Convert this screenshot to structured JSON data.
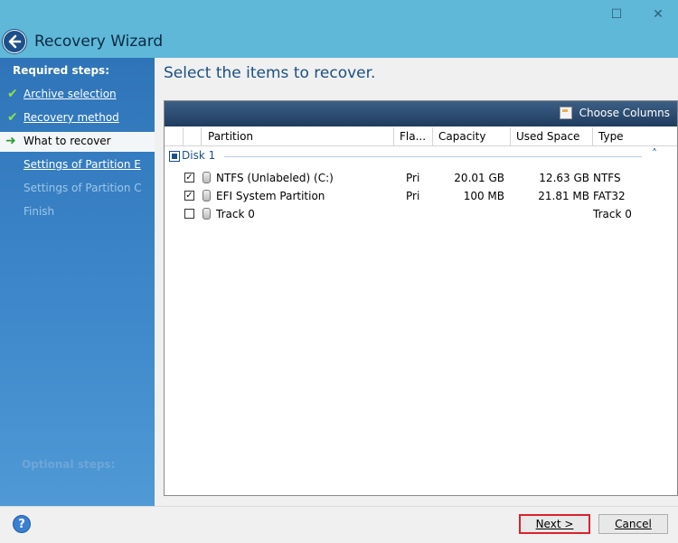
{
  "window": {
    "title": "Recovery Wizard",
    "maximize_glyph": "☐",
    "close_glyph": "✕",
    "back_icon": "back-arrow-icon"
  },
  "sidebar": {
    "heading": "Required steps:",
    "steps": [
      {
        "label": "Archive selection",
        "state": "done"
      },
      {
        "label": "Recovery method",
        "state": "done"
      },
      {
        "label": "What to recover",
        "state": "current"
      },
      {
        "label": "Settings of Partition E",
        "state": "next"
      },
      {
        "label": "Settings of Partition C",
        "state": "pending"
      },
      {
        "label": "Finish",
        "state": "pending"
      }
    ],
    "optional_heading": "Optional steps:"
  },
  "main": {
    "title": "Select the items to recover.",
    "toolbar": {
      "choose_columns": "Choose Columns"
    },
    "columns": [
      "Partition",
      "Fla...",
      "Capacity",
      "Used Space",
      "Type"
    ],
    "disk": {
      "label": "Disk 1",
      "collapse_glyph": "˄"
    },
    "rows": [
      {
        "checked": true,
        "name": "NTFS (Unlabeled) (C:)",
        "flags": "Pri",
        "capacity": "20.01 GB",
        "used": "12.63 GB",
        "type": "NTFS"
      },
      {
        "checked": true,
        "name": "EFI System Partition",
        "flags": "Pri",
        "capacity": "100 MB",
        "used": "21.81 MB",
        "type": "FAT32"
      },
      {
        "checked": false,
        "name": "Track 0",
        "flags": "",
        "capacity": "",
        "used": "",
        "type": "Track 0"
      }
    ]
  },
  "footer": {
    "help_glyph": "?",
    "next_label": "Next >",
    "cancel_label": "Cancel"
  }
}
